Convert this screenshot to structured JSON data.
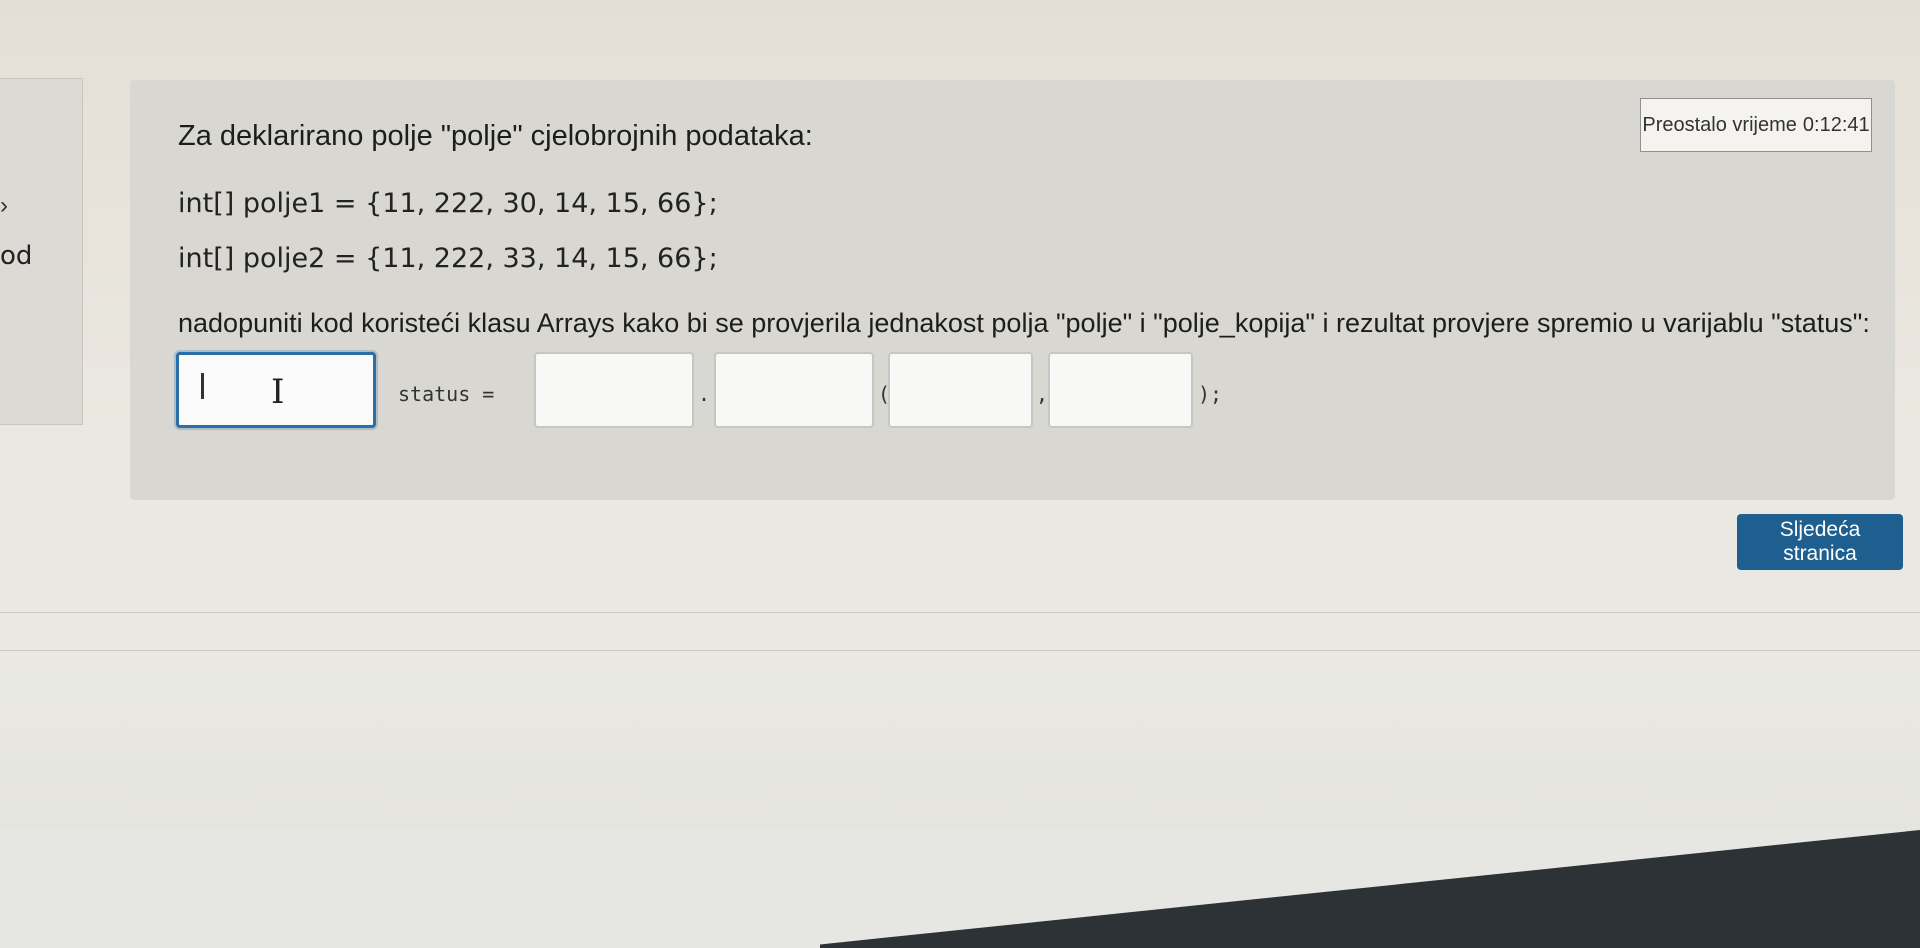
{
  "sidebar": {
    "fragment_arrow": "›",
    "fragment_text": "od"
  },
  "timer": {
    "label": "Preostalo vrijeme",
    "value": "0:12:41"
  },
  "question": {
    "title": "Za deklarirano polje \"polje\" cjelobrojnih podataka:",
    "code_line_1": "int[] polje1 = {11, 222, 30, 14, 15, 66};",
    "code_line_2": "int[] polje2 = {11, 222, 33, 14, 15, 66};",
    "instruction_main": "nadopuniti kod koristeći klasu Arrays kako bi se provjerila jednakost polja \"polje\" i \"polje_kopija\" i rezultat provjere spremio u varijablu \"status\":",
    "instruction_tail": "",
    "answer": {
      "status_label": "status =",
      "dot": ".",
      "open_paren": "(",
      "comma": ",",
      "close": ");",
      "blanks": [
        "",
        "",
        "",
        "",
        ""
      ]
    }
  },
  "navigation": {
    "next_label": "Sljedeća stranica"
  }
}
